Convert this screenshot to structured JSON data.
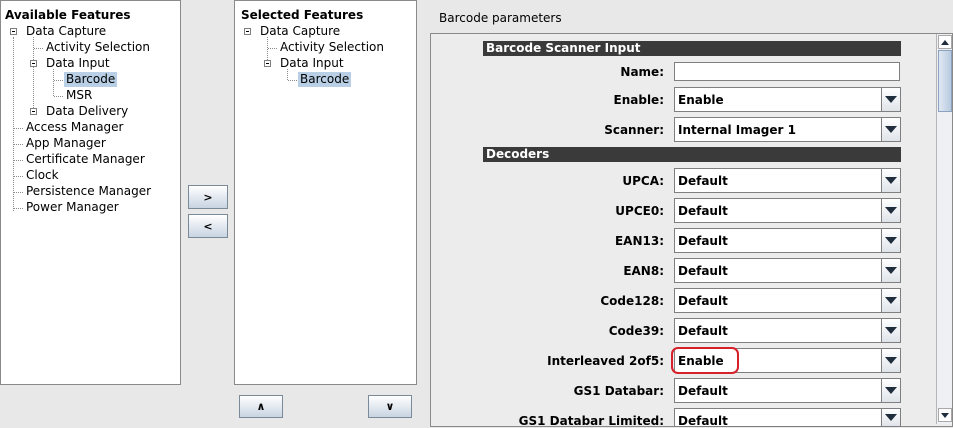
{
  "available": {
    "title": "Available Features",
    "items": [
      "Data Capture",
      "Activity Selection",
      "Data Input",
      "Barcode",
      "MSR",
      "Data Delivery",
      "Access Manager",
      "App Manager",
      "Certificate Manager",
      "Clock",
      "Persistence Manager",
      "Power Manager"
    ]
  },
  "buttons": {
    "add": ">",
    "remove": "<",
    "up": "∧",
    "down": "∨"
  },
  "selected": {
    "title": "Selected Features",
    "items": [
      "Data Capture",
      "Activity Selection",
      "Data Input",
      "Barcode"
    ]
  },
  "params": {
    "title": "Barcode parameters",
    "sections": {
      "scanner_input": "Barcode Scanner Input",
      "decoders": "Decoders"
    },
    "name_label": "Name:",
    "name_value": "",
    "enable_label": "Enable:",
    "enable_value": "Enable",
    "scanner_label": "Scanner:",
    "scanner_value": "Internal Imager 1",
    "decoders": [
      {
        "label": "UPCA:",
        "value": "Default"
      },
      {
        "label": "UPCE0:",
        "value": "Default"
      },
      {
        "label": "EAN13:",
        "value": "Default"
      },
      {
        "label": "EAN8:",
        "value": "Default"
      },
      {
        "label": "Code128:",
        "value": "Default"
      },
      {
        "label": "Code39:",
        "value": "Default"
      },
      {
        "label": "Interleaved 2of5:",
        "value": "Enable"
      },
      {
        "label": "GS1 Databar:",
        "value": "Default"
      },
      {
        "label": "GS1 Databar Limited:",
        "value": "Default"
      }
    ]
  },
  "colors": {
    "selection": "#b8cfe5",
    "highlight": "#d6202a",
    "section_bar": "#3a3a3a"
  }
}
